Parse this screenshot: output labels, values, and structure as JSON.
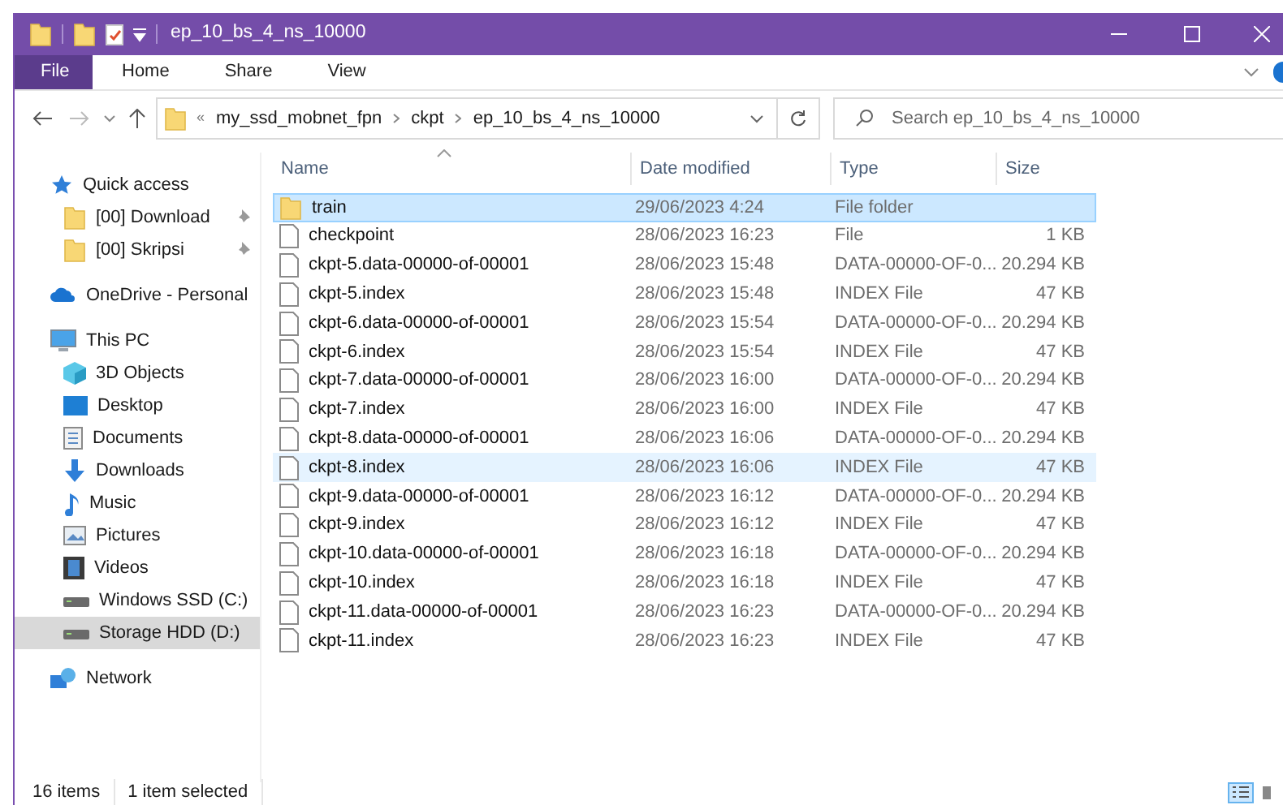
{
  "window": {
    "title": "ep_10_bs_4_ns_10000"
  },
  "ribbon_tabs": [
    {
      "label": "File",
      "selected": true
    },
    {
      "label": "Home",
      "selected": false
    },
    {
      "label": "Share",
      "selected": false
    },
    {
      "label": "View",
      "selected": false
    }
  ],
  "address": {
    "overflow": "«",
    "crumbs": [
      "my_ssd_mobnet_fpn",
      "ckpt",
      "ep_10_bs_4_ns_10000"
    ]
  },
  "search": {
    "placeholder": "Search ep_10_bs_4_ns_10000"
  },
  "sidebar": [
    {
      "label": "Quick access",
      "kind": "star",
      "selected": false,
      "children": [
        {
          "label": "[00] Download",
          "kind": "folder",
          "pinned": true,
          "selected": false
        },
        {
          "label": "[00] Skripsi",
          "kind": "folder",
          "pinned": true,
          "selected": false
        }
      ]
    },
    {
      "label": "OneDrive - Personal",
      "kind": "cloud",
      "selected": false
    },
    {
      "label": "This PC",
      "kind": "pc",
      "selected": false,
      "children": [
        {
          "label": "3D Objects",
          "kind": "cube",
          "selected": false
        },
        {
          "label": "Desktop",
          "kind": "desktop",
          "selected": false
        },
        {
          "label": "Documents",
          "kind": "document",
          "selected": false
        },
        {
          "label": "Downloads",
          "kind": "download",
          "selected": false
        },
        {
          "label": "Music",
          "kind": "music",
          "selected": false
        },
        {
          "label": "Pictures",
          "kind": "pictures",
          "selected": false
        },
        {
          "label": "Videos",
          "kind": "video",
          "selected": false
        },
        {
          "label": "Windows SSD (C:)",
          "kind": "drive",
          "selected": false
        },
        {
          "label": "Storage HDD (D:)",
          "kind": "drive",
          "selected": true
        }
      ]
    },
    {
      "label": "Network",
      "kind": "network",
      "selected": false
    }
  ],
  "table": {
    "columns": [
      "Name",
      "Date modified",
      "Type",
      "Size"
    ],
    "rows": [
      {
        "kind": "folder",
        "name": "train",
        "date": "29/06/2023 4:24",
        "type": "File folder",
        "selected": true,
        "hovered": false
      },
      {
        "kind": "file",
        "name": "checkpoint",
        "date": "28/06/2023 16:23",
        "type": "File",
        "size": "1 KB",
        "selected": false,
        "hovered": false
      },
      {
        "kind": "file",
        "name": "ckpt-5.data-00000-of-00001",
        "date": "28/06/2023 15:48",
        "type": "DATA-00000-OF-0...",
        "size": "20.294 KB",
        "selected": false,
        "hovered": false
      },
      {
        "kind": "file",
        "name": "ckpt-5.index",
        "date": "28/06/2023 15:48",
        "type": "INDEX File",
        "size": "47 KB",
        "selected": false,
        "hovered": false
      },
      {
        "kind": "file",
        "name": "ckpt-6.data-00000-of-00001",
        "date": "28/06/2023 15:54",
        "type": "DATA-00000-OF-0...",
        "size": "20.294 KB",
        "selected": false,
        "hovered": false
      },
      {
        "kind": "file",
        "name": "ckpt-6.index",
        "date": "28/06/2023 15:54",
        "type": "INDEX File",
        "size": "47 KB",
        "selected": false,
        "hovered": false
      },
      {
        "kind": "file",
        "name": "ckpt-7.data-00000-of-00001",
        "date": "28/06/2023 16:00",
        "type": "DATA-00000-OF-0...",
        "size": "20.294 KB",
        "selected": false,
        "hovered": false
      },
      {
        "kind": "file",
        "name": "ckpt-7.index",
        "date": "28/06/2023 16:00",
        "type": "INDEX File",
        "size": "47 KB",
        "selected": false,
        "hovered": false
      },
      {
        "kind": "file",
        "name": "ckpt-8.data-00000-of-00001",
        "date": "28/06/2023 16:06",
        "type": "DATA-00000-OF-0...",
        "size": "20.294 KB",
        "selected": false,
        "hovered": false
      },
      {
        "kind": "file",
        "name": "ckpt-8.index",
        "date": "28/06/2023 16:06",
        "type": "INDEX File",
        "size": "47 KB",
        "selected": false,
        "hovered": true
      },
      {
        "kind": "file",
        "name": "ckpt-9.data-00000-of-00001",
        "date": "28/06/2023 16:12",
        "type": "DATA-00000-OF-0...",
        "size": "20.294 KB",
        "selected": false,
        "hovered": false
      },
      {
        "kind": "file",
        "name": "ckpt-9.index",
        "date": "28/06/2023 16:12",
        "type": "INDEX File",
        "size": "47 KB",
        "selected": false,
        "hovered": false
      },
      {
        "kind": "file",
        "name": "ckpt-10.data-00000-of-00001",
        "date": "28/06/2023 16:18",
        "type": "DATA-00000-OF-0...",
        "size": "20.294 KB",
        "selected": false,
        "hovered": false
      },
      {
        "kind": "file",
        "name": "ckpt-10.index",
        "date": "28/06/2023 16:18",
        "type": "INDEX File",
        "size": "47 KB",
        "selected": false,
        "hovered": false
      },
      {
        "kind": "file",
        "name": "ckpt-11.data-00000-of-00001",
        "date": "28/06/2023 16:23",
        "type": "DATA-00000-OF-0...",
        "size": "20.294 KB",
        "selected": false,
        "hovered": false
      },
      {
        "kind": "file",
        "name": "ckpt-11.index",
        "date": "28/06/2023 16:23",
        "type": "INDEX File",
        "size": "47 KB",
        "selected": false,
        "hovered": false
      }
    ]
  },
  "status_bar": {
    "count": "16 items",
    "selection": "1 item selected"
  },
  "view_buttons": [
    {
      "kind": "details",
      "selected": true
    },
    {
      "kind": "tiles",
      "selected": false
    }
  ]
}
